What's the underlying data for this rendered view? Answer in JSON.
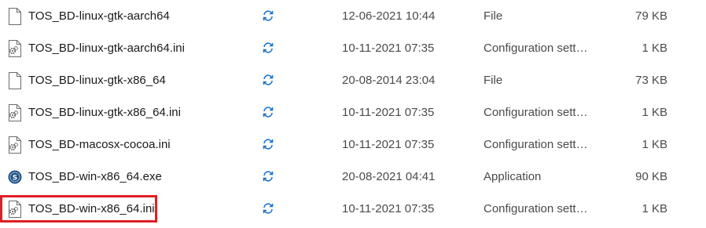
{
  "files": [
    {
      "name": "TOS_BD-linux-gtk-aarch64",
      "icon": "blank-file-icon",
      "status_icon": "sync-icon",
      "date": "12-06-2021 10:44",
      "type": "File",
      "size": "79 KB"
    },
    {
      "name": "TOS_BD-linux-gtk-aarch64.ini",
      "icon": "config-file-icon",
      "status_icon": "sync-icon",
      "date": "10-11-2021 07:35",
      "type": "Configuration setti…",
      "size": "1 KB"
    },
    {
      "name": "TOS_BD-linux-gtk-x86_64",
      "icon": "blank-file-icon",
      "status_icon": "sync-icon",
      "date": "20-08-2014 23:04",
      "type": "File",
      "size": "73 KB"
    },
    {
      "name": "TOS_BD-linux-gtk-x86_64.ini",
      "icon": "config-file-icon",
      "status_icon": "sync-icon",
      "date": "10-11-2021 07:35",
      "type": "Configuration setti…",
      "size": "1 KB"
    },
    {
      "name": "TOS_BD-macosx-cocoa.ini",
      "icon": "config-file-icon",
      "status_icon": "sync-icon",
      "date": "10-11-2021 07:35",
      "type": "Configuration setti…",
      "size": "1 KB"
    },
    {
      "name": "TOS_BD-win-x86_64.exe",
      "icon": "application-icon",
      "status_icon": "sync-icon",
      "date": "20-08-2021 04:41",
      "type": "Application",
      "size": "90 KB"
    },
    {
      "name": "TOS_BD-win-x86_64.ini",
      "icon": "config-file-icon",
      "status_icon": "sync-icon",
      "date": "10-11-2021 07:35",
      "type": "Configuration setti…",
      "size": "1 KB"
    }
  ],
  "colors": {
    "sync": "#1a73c8",
    "highlight_border": "#e01e24",
    "app_icon": "#1f4f7f"
  }
}
